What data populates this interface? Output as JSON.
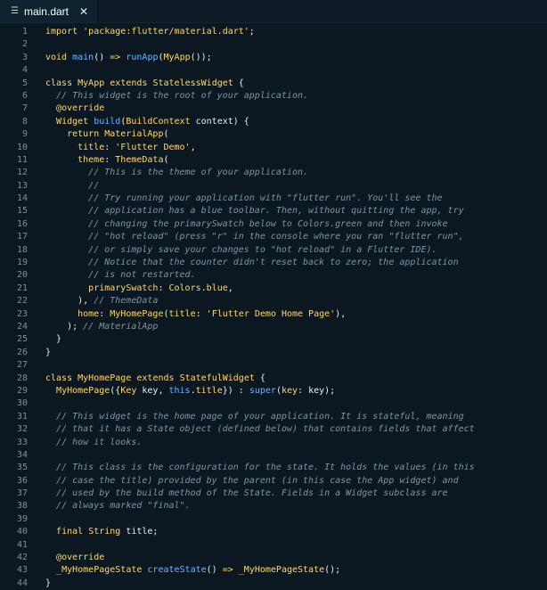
{
  "tab": {
    "filename": "main.dart",
    "menu_glyph": "☰",
    "close_glyph": "✕"
  },
  "lines": [
    [
      [
        "kw",
        "import"
      ],
      [
        "plain",
        " "
      ],
      [
        "str",
        "'package:flutter/material.dart'"
      ],
      [
        "plain",
        ";"
      ]
    ],
    [],
    [
      [
        "kw",
        "void"
      ],
      [
        "plain",
        " "
      ],
      [
        "fn",
        "main"
      ],
      [
        "plain",
        "() "
      ],
      [
        "kw",
        "=>"
      ],
      [
        "plain",
        " "
      ],
      [
        "fn",
        "runApp"
      ],
      [
        "plain",
        "("
      ],
      [
        "ty",
        "MyApp"
      ],
      [
        "plain",
        "());"
      ]
    ],
    [],
    [
      [
        "kw",
        "class"
      ],
      [
        "plain",
        " "
      ],
      [
        "ty",
        "MyApp"
      ],
      [
        "plain",
        " "
      ],
      [
        "kw",
        "extends"
      ],
      [
        "plain",
        " "
      ],
      [
        "ty",
        "StatelessWidget"
      ],
      [
        "plain",
        " {"
      ]
    ],
    [
      [
        "plain",
        "  "
      ],
      [
        "cm",
        "// This widget is the root of your application."
      ]
    ],
    [
      [
        "plain",
        "  "
      ],
      [
        "ann",
        "@override"
      ]
    ],
    [
      [
        "plain",
        "  "
      ],
      [
        "ty",
        "Widget"
      ],
      [
        "plain",
        " "
      ],
      [
        "fn",
        "build"
      ],
      [
        "plain",
        "("
      ],
      [
        "ty",
        "BuildContext"
      ],
      [
        "plain",
        " context) {"
      ]
    ],
    [
      [
        "plain",
        "    "
      ],
      [
        "kw",
        "return"
      ],
      [
        "plain",
        " "
      ],
      [
        "ty",
        "MaterialApp"
      ],
      [
        "plain",
        "("
      ]
    ],
    [
      [
        "plain",
        "      "
      ],
      [
        "prop",
        "title"
      ],
      [
        "plain",
        ": "
      ],
      [
        "str",
        "'Flutter Demo'"
      ],
      [
        "plain",
        ","
      ]
    ],
    [
      [
        "plain",
        "      "
      ],
      [
        "prop",
        "theme"
      ],
      [
        "plain",
        ": "
      ],
      [
        "ty",
        "ThemeData"
      ],
      [
        "plain",
        "("
      ]
    ],
    [
      [
        "plain",
        "        "
      ],
      [
        "cm",
        "// This is the theme of your application."
      ]
    ],
    [
      [
        "plain",
        "        "
      ],
      [
        "cm",
        "//"
      ]
    ],
    [
      [
        "plain",
        "        "
      ],
      [
        "cm",
        "// Try running your application with \"flutter run\". You'll see the"
      ]
    ],
    [
      [
        "plain",
        "        "
      ],
      [
        "cm",
        "// application has a blue toolbar. Then, without quitting the app, try"
      ]
    ],
    [
      [
        "plain",
        "        "
      ],
      [
        "cm",
        "// changing the primarySwatch below to Colors.green and then invoke"
      ]
    ],
    [
      [
        "plain",
        "        "
      ],
      [
        "cm",
        "// \"hot reload\" (press \"r\" in the console where you ran \"flutter run\","
      ]
    ],
    [
      [
        "plain",
        "        "
      ],
      [
        "cm",
        "// or simply save your changes to \"hot reload\" in a Flutter IDE)."
      ]
    ],
    [
      [
        "plain",
        "        "
      ],
      [
        "cm",
        "// Notice that the counter didn't reset back to zero; the application"
      ]
    ],
    [
      [
        "plain",
        "        "
      ],
      [
        "cm",
        "// is not restarted."
      ]
    ],
    [
      [
        "plain",
        "        "
      ],
      [
        "prop",
        "primarySwatch"
      ],
      [
        "plain",
        ": "
      ],
      [
        "ty",
        "Colors"
      ],
      [
        "plain",
        "."
      ],
      [
        "prop",
        "blue"
      ],
      [
        "plain",
        ","
      ]
    ],
    [
      [
        "plain",
        "      ), "
      ],
      [
        "cm",
        "// ThemeData"
      ]
    ],
    [
      [
        "plain",
        "      "
      ],
      [
        "prop",
        "home"
      ],
      [
        "plain",
        ": "
      ],
      [
        "ty",
        "MyHomePage"
      ],
      [
        "plain",
        "("
      ],
      [
        "prop",
        "title"
      ],
      [
        "plain",
        ": "
      ],
      [
        "str",
        "'Flutter Demo Home Page'"
      ],
      [
        "plain",
        "),"
      ]
    ],
    [
      [
        "plain",
        "    ); "
      ],
      [
        "cm",
        "// MaterialApp"
      ]
    ],
    [
      [
        "plain",
        "  }"
      ]
    ],
    [
      [
        "plain",
        "}"
      ]
    ],
    [],
    [
      [
        "kw",
        "class"
      ],
      [
        "plain",
        " "
      ],
      [
        "ty",
        "MyHomePage"
      ],
      [
        "plain",
        " "
      ],
      [
        "kw",
        "extends"
      ],
      [
        "plain",
        " "
      ],
      [
        "ty",
        "StatefulWidget"
      ],
      [
        "plain",
        " {"
      ]
    ],
    [
      [
        "plain",
        "  "
      ],
      [
        "ty",
        "MyHomePage"
      ],
      [
        "plain",
        "({"
      ],
      [
        "ty",
        "Key"
      ],
      [
        "plain",
        " key, "
      ],
      [
        "fn",
        "this"
      ],
      [
        "plain",
        "."
      ],
      [
        "prop",
        "title"
      ],
      [
        "plain",
        "}) : "
      ],
      [
        "fn",
        "super"
      ],
      [
        "plain",
        "("
      ],
      [
        "prop",
        "key"
      ],
      [
        "plain",
        ": key);"
      ]
    ],
    [],
    [
      [
        "plain",
        "  "
      ],
      [
        "cm",
        "// This widget is the home page of your application. It is stateful, meaning"
      ]
    ],
    [
      [
        "plain",
        "  "
      ],
      [
        "cm",
        "// that it has a State object (defined below) that contains fields that affect"
      ]
    ],
    [
      [
        "plain",
        "  "
      ],
      [
        "cm",
        "// how it looks."
      ]
    ],
    [],
    [
      [
        "plain",
        "  "
      ],
      [
        "cm",
        "// This class is the configuration for the state. It holds the values (in this"
      ]
    ],
    [
      [
        "plain",
        "  "
      ],
      [
        "cm",
        "// case the title) provided by the parent (in this case the App widget) and"
      ]
    ],
    [
      [
        "plain",
        "  "
      ],
      [
        "cm",
        "// used by the build method of the State. Fields in a Widget subclass are"
      ]
    ],
    [
      [
        "plain",
        "  "
      ],
      [
        "cm",
        "// always marked \"final\"."
      ]
    ],
    [],
    [
      [
        "plain",
        "  "
      ],
      [
        "kw",
        "final"
      ],
      [
        "plain",
        " "
      ],
      [
        "ty",
        "String"
      ],
      [
        "plain",
        " title;"
      ]
    ],
    [],
    [
      [
        "plain",
        "  "
      ],
      [
        "ann",
        "@override"
      ]
    ],
    [
      [
        "plain",
        "  "
      ],
      [
        "ty",
        "_MyHomePageState"
      ],
      [
        "plain",
        " "
      ],
      [
        "fn",
        "createState"
      ],
      [
        "plain",
        "() "
      ],
      [
        "kw",
        "=>"
      ],
      [
        "plain",
        " "
      ],
      [
        "ty",
        "_MyHomePageState"
      ],
      [
        "plain",
        "();"
      ]
    ],
    [
      [
        "plain",
        "}"
      ]
    ]
  ]
}
